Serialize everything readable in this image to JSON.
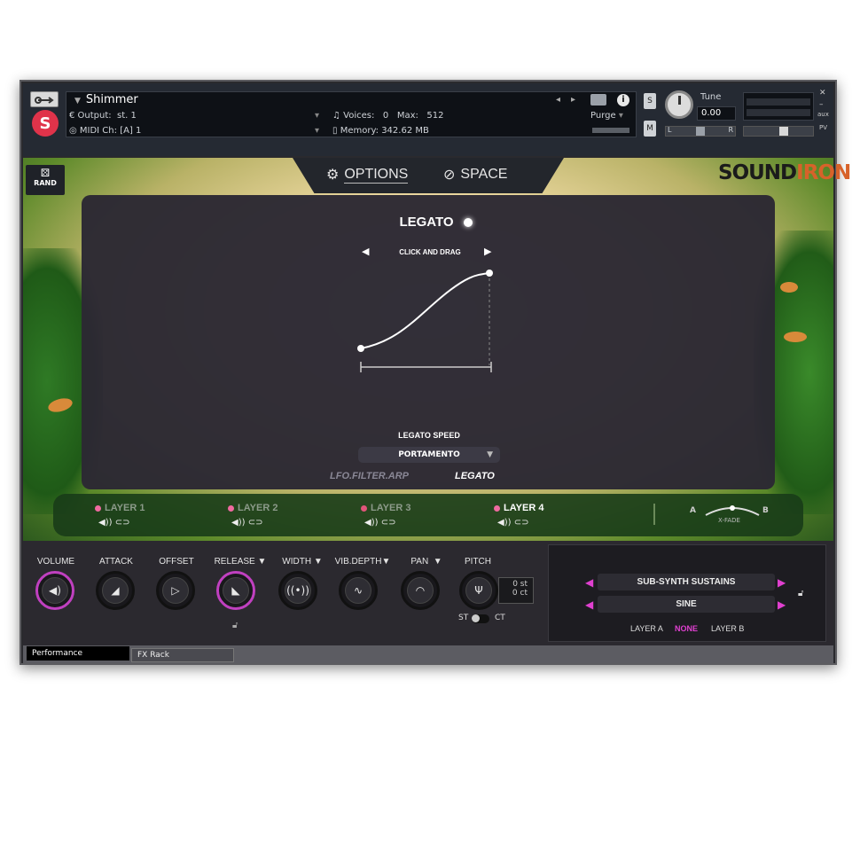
{
  "header": {
    "instrument_name": "Shimmer",
    "output_label": "Output:",
    "output_value": "st. 1",
    "midi_label": "MIDI Ch:",
    "midi_value": "[A] 1",
    "voices_label": "Voices:",
    "voices_value": "0",
    "max_label": "Max:",
    "max_value": "512",
    "memory_label": "Memory:",
    "memory_value": "342.62 MB",
    "purge_label": "Purge",
    "tune_label": "Tune",
    "tune_value": "0.00",
    "solo_label": "S",
    "mute_label": "M",
    "aux_label": "aux",
    "pv_label": "PV",
    "pan_l": "L",
    "pan_r": "R"
  },
  "rand_label": "RAND",
  "tabs": [
    {
      "label": "OPTIONS",
      "icon": "gear-icon"
    },
    {
      "label": "SPACE",
      "icon": "planet-icon"
    }
  ],
  "brand": {
    "part1": "SOUND",
    "part2": "IRON"
  },
  "legato": {
    "title": "LEGATO",
    "curve_hint": "CLICK AND DRAG",
    "speed_label": "LEGATO SPEED",
    "speed_value": "PORTAMENTO",
    "nav_left": "LFO.FILTER.ARP",
    "nav_right": "LEGATO"
  },
  "layers": [
    {
      "label": "LAYER 1",
      "active": false
    },
    {
      "label": "LAYER 2",
      "active": false
    },
    {
      "label": "LAYER 3",
      "active": false
    },
    {
      "label": "LAYER 4",
      "active": true
    }
  ],
  "xfade": {
    "a": "A",
    "b": "B",
    "label": "X-FADE"
  },
  "knobs": [
    {
      "label": "VOLUME",
      "icon": "speaker-icon",
      "dropdown": false
    },
    {
      "label": "ATTACK",
      "icon": "attack-ramp-icon",
      "dropdown": false
    },
    {
      "label": "OFFSET",
      "icon": "offset-icon",
      "dropdown": false
    },
    {
      "label": "RELEASE",
      "icon": "release-ramp-icon",
      "dropdown": true
    },
    {
      "label": "WIDTH",
      "icon": "width-icon",
      "dropdown": true
    },
    {
      "label": "VIB.DEPTH",
      "icon": "vibrato-icon",
      "dropdown": true
    },
    {
      "label": "PAN",
      "icon": "pan-icon",
      "dropdown": true
    },
    {
      "label": "PITCH",
      "icon": "tuning-fork-icon",
      "dropdown": false
    }
  ],
  "pitch": {
    "st_value": "0 st",
    "ct_value": "0 ct",
    "st_label": "ST",
    "ct_label": "CT"
  },
  "synth": {
    "preset1": "SUB-SYNTH SUSTAINS",
    "preset2": "SINE",
    "layer_a": "LAYER A",
    "layer_none": "NONE",
    "layer_b": "LAYER B"
  },
  "bottom_tabs": [
    "Performance",
    "FX Rack"
  ],
  "colors": {
    "accent": "#e040d0",
    "layer_dot": "#f06aa0"
  }
}
